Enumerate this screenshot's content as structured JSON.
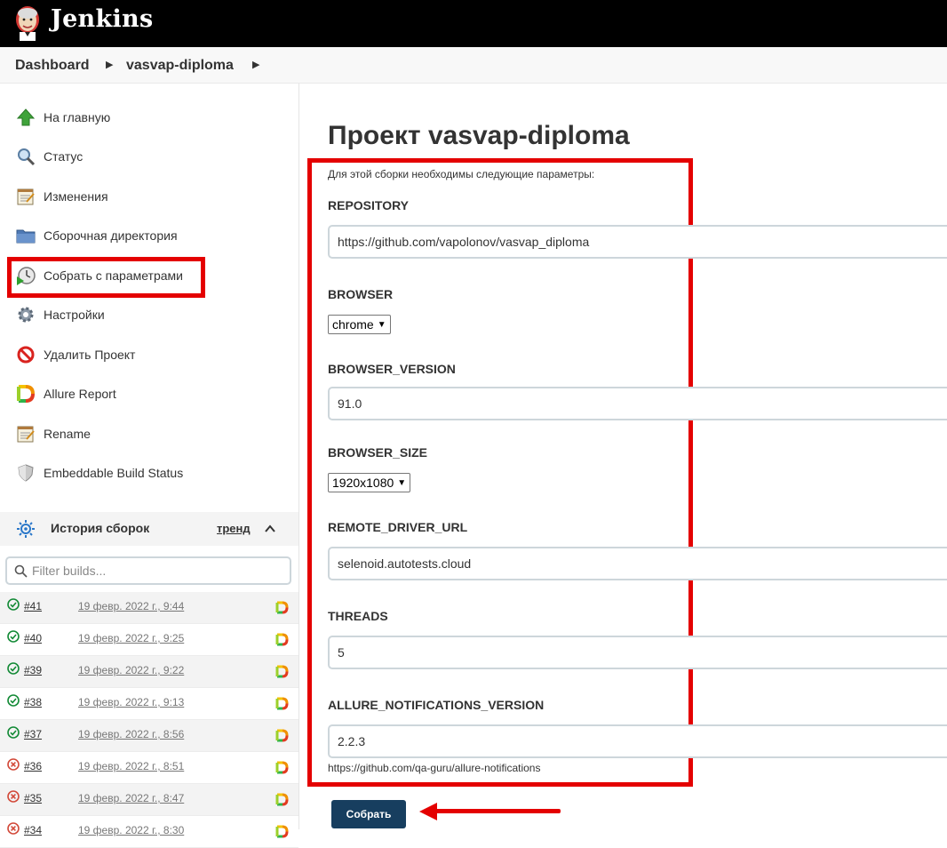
{
  "header": {
    "brand": "Jenkins"
  },
  "breadcrumb": {
    "items": [
      "Dashboard",
      "vasvap-diploma"
    ]
  },
  "sidebar": {
    "tasks": [
      {
        "label": "На главную",
        "icon": "up-arrow-icon"
      },
      {
        "label": "Статус",
        "icon": "magnifier-icon"
      },
      {
        "label": "Изменения",
        "icon": "notepad-icon"
      },
      {
        "label": "Сборочная директория",
        "icon": "folder-icon"
      },
      {
        "label": "Собрать с параметрами",
        "icon": "clock-play-icon"
      },
      {
        "label": "Настройки",
        "icon": "gear-icon"
      },
      {
        "label": "Удалить Проект",
        "icon": "no-entry-icon"
      },
      {
        "label": "Allure Report",
        "icon": "allure-icon"
      },
      {
        "label": "Rename",
        "icon": "notepad-icon"
      },
      {
        "label": "Embeddable Build Status",
        "icon": "shield-icon"
      }
    ]
  },
  "history": {
    "title": "История сборок",
    "trend": "тренд",
    "filter_placeholder": "Filter builds...",
    "builds": [
      {
        "number": "#41",
        "date": "19 февр. 2022 г., 9:44",
        "status": "success"
      },
      {
        "number": "#40",
        "date": "19 февр. 2022 г., 9:25",
        "status": "success"
      },
      {
        "number": "#39",
        "date": "19 февр. 2022 г., 9:22",
        "status": "success"
      },
      {
        "number": "#38",
        "date": "19 февр. 2022 г., 9:13",
        "status": "success"
      },
      {
        "number": "#37",
        "date": "19 февр. 2022 г., 8:56",
        "status": "success"
      },
      {
        "number": "#36",
        "date": "19 февр. 2022 г., 8:51",
        "status": "failure"
      },
      {
        "number": "#35",
        "date": "19 февр. 2022 г., 8:47",
        "status": "failure"
      },
      {
        "number": "#34",
        "date": "19 февр. 2022 г., 8:30",
        "status": "failure"
      }
    ]
  },
  "main": {
    "title": "Проект vasvap-diploma",
    "description": "Для этой сборки необходимы следующие параметры:",
    "params": {
      "repository": {
        "label": "REPOSITORY",
        "value": "https://github.com/vapolonov/vasvap_diploma"
      },
      "browser": {
        "label": "BROWSER",
        "value": "chrome"
      },
      "browser_version": {
        "label": "BROWSER_VERSION",
        "value": "91.0"
      },
      "browser_size": {
        "label": "BROWSER_SIZE",
        "value": "1920x1080"
      },
      "remote_driver_url": {
        "label": "REMOTE_DRIVER_URL",
        "value": "selenoid.autotests.cloud"
      },
      "threads": {
        "label": "THREADS",
        "value": "5"
      },
      "allure_notifications_version": {
        "label": "ALLURE_NOTIFICATIONS_VERSION",
        "value": "2.2.3",
        "help": "https://github.com/qa-guru/allure-notifications"
      }
    },
    "submit_label": "Собрать"
  },
  "colors": {
    "highlight": "#e40000",
    "button": "#173e5f",
    "success": "#138a36",
    "failure": "#d24939"
  }
}
